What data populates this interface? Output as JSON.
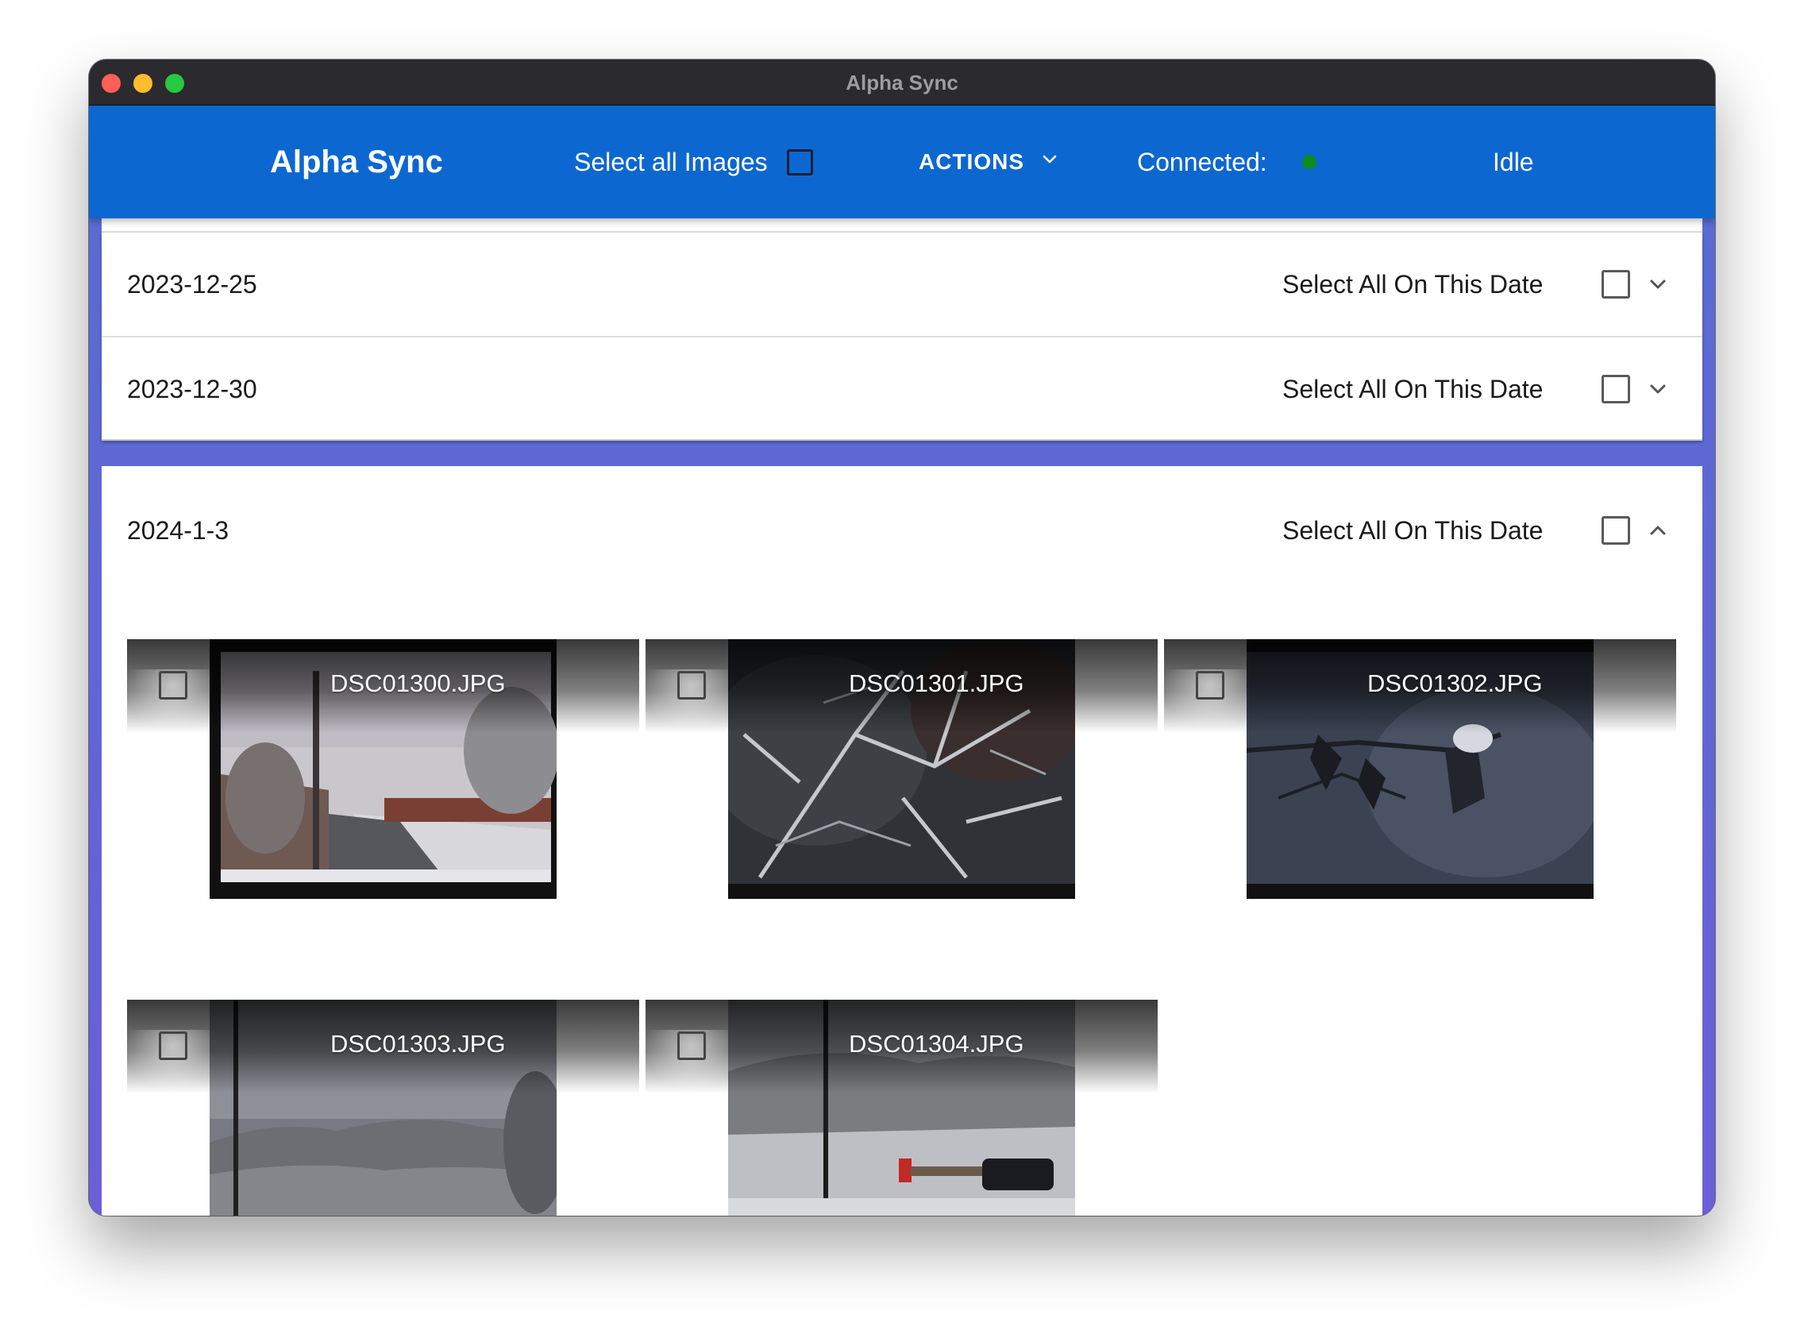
{
  "window": {
    "title": "Alpha Sync"
  },
  "appbar": {
    "brand": "Alpha Sync",
    "select_all_label": "Select all Images",
    "actions_label": "ACTIONS",
    "connected_label": "Connected:",
    "connection_color": "#0e8a23",
    "status": "Idle",
    "color": "#0d67d0"
  },
  "groups": [
    {
      "date": "2023-12-25",
      "select_label": "Select All On This Date",
      "expanded": false
    },
    {
      "date": "2023-12-30",
      "select_label": "Select All On This Date",
      "expanded": false
    },
    {
      "date": "2024-1-3",
      "select_label": "Select All On This Date",
      "expanded": true,
      "images": [
        {
          "filename": "DSC01300.JPG"
        },
        {
          "filename": "DSC01301.JPG"
        },
        {
          "filename": "DSC01302.JPG"
        },
        {
          "filename": "DSC01303.JPG"
        },
        {
          "filename": "DSC01304.JPG"
        }
      ]
    }
  ]
}
